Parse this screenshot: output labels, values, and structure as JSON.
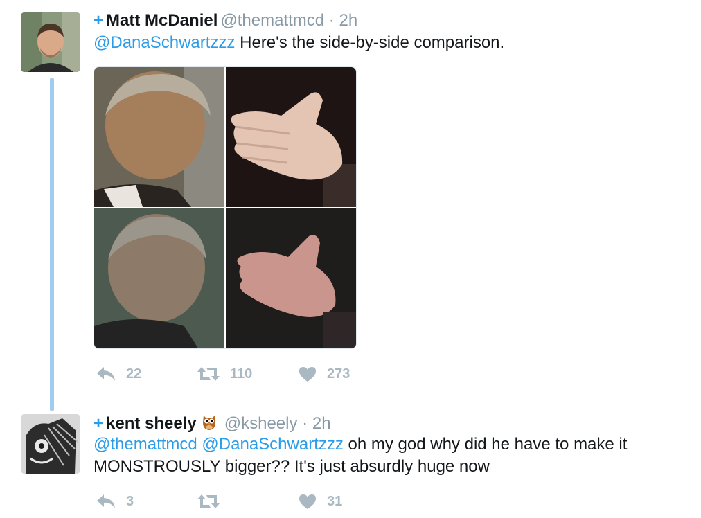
{
  "tweets": [
    {
      "follow_symbol": "+",
      "name": "Matt McDaniel",
      "handle": "@themattmcd",
      "separator": "·",
      "time": "2h",
      "mention": "@DanaSchwartzzz",
      "text": " Here's the side-by-side comparison.",
      "media_cells": [
        "head-top-left",
        "hand-top-right",
        "head-bottom-left",
        "hand-bottom-right"
      ],
      "replies": "22",
      "retweets": "110",
      "likes": "273"
    },
    {
      "follow_symbol": "+",
      "name": "kent sheely",
      "name_emoji": "owl",
      "handle": "@ksheely",
      "separator": "·",
      "time": "2h",
      "mention_1": "@themattmcd",
      "mention_2": "@DanaSchwartzzz",
      "text_line1": " oh my god why did he have to make it",
      "text_line2": "MONSTROUSLY bigger?? It's just absurdly huge now",
      "replies": "3",
      "retweets": "",
      "likes": "31"
    }
  ],
  "colors": {
    "accent": "#2b9ce8",
    "thread_line": "#9fcdf0",
    "muted": "#8899a6",
    "action_gray": "#aab8c2"
  }
}
